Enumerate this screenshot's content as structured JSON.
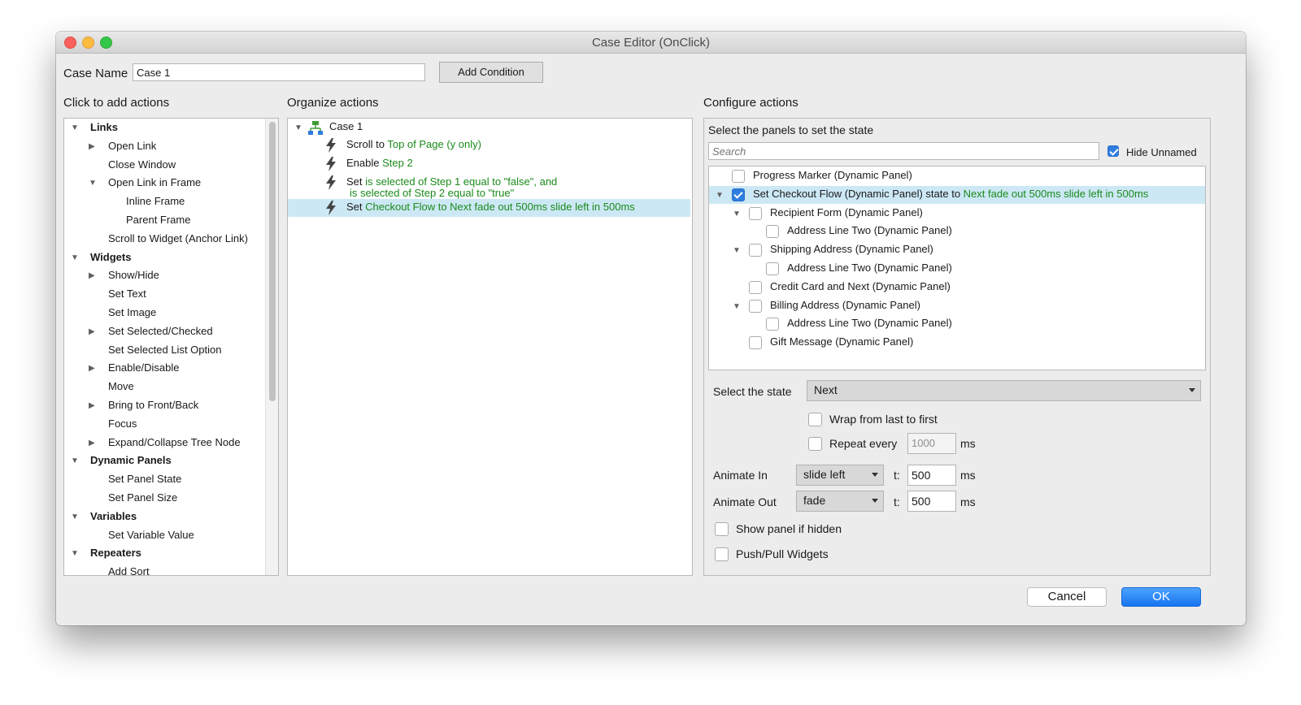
{
  "window": {
    "title": "Case Editor (OnClick)"
  },
  "case_name": {
    "label": "Case Name",
    "value": "Case 1"
  },
  "add_condition_label": "Add Condition",
  "left": {
    "header": "Click to add actions",
    "items": [
      {
        "label": "Links",
        "bold": true,
        "expanded": true
      },
      {
        "label": "Open Link",
        "has_children": true
      },
      {
        "label": "Close Window"
      },
      {
        "label": "Open Link in Frame",
        "expanded": true
      },
      {
        "label": "Inline Frame"
      },
      {
        "label": "Parent Frame"
      },
      {
        "label": "Scroll to Widget (Anchor Link)"
      },
      {
        "label": "Widgets",
        "bold": true,
        "expanded": true
      },
      {
        "label": "Show/Hide",
        "has_children": true
      },
      {
        "label": "Set Text"
      },
      {
        "label": "Set Image"
      },
      {
        "label": "Set Selected/Checked",
        "has_children": true
      },
      {
        "label": "Set Selected List Option"
      },
      {
        "label": "Enable/Disable",
        "has_children": true
      },
      {
        "label": "Move"
      },
      {
        "label": "Bring to Front/Back",
        "has_children": true
      },
      {
        "label": "Focus"
      },
      {
        "label": "Expand/Collapse Tree Node",
        "has_children": true
      },
      {
        "label": "Dynamic Panels",
        "bold": true,
        "expanded": true
      },
      {
        "label": "Set Panel State"
      },
      {
        "label": "Set Panel Size"
      },
      {
        "label": "Variables",
        "bold": true,
        "expanded": true
      },
      {
        "label": "Set Variable Value"
      },
      {
        "label": "Repeaters",
        "bold": true,
        "expanded": true
      },
      {
        "label": "Add Sort"
      }
    ]
  },
  "middle": {
    "header": "Organize actions",
    "case_label": "Case 1",
    "actions": [
      {
        "prefix": "Scroll to ",
        "detail": "Top of Page (y only)"
      },
      {
        "prefix": "Enable ",
        "detail": "Step 2"
      },
      {
        "prefix": "Set ",
        "detail": "is selected of Step 1 equal to \"false\", and",
        "detail2": "is selected of Step 2 equal to \"true\""
      },
      {
        "prefix": "Set ",
        "detail": "Checkout Flow to Next fade out 500ms slide left in 500ms",
        "selected": true
      }
    ]
  },
  "right": {
    "header": "Configure actions",
    "panels_label": "Select the panels to set the state",
    "search_placeholder": "Search",
    "hide_unnamed_label": "Hide Unnamed",
    "hide_unnamed_checked": true,
    "panels": [
      {
        "label": "Progress Marker (Dynamic Panel)",
        "checked": false
      },
      {
        "label": "Set Checkout Flow (Dynamic Panel) state to ",
        "detail": "Next fade out 500ms slide left in 500ms",
        "checked": true,
        "selected": true
      },
      {
        "label": "Recipient Form (Dynamic Panel)",
        "checked": false
      },
      {
        "label": "Address Line Two (Dynamic Panel)",
        "checked": false
      },
      {
        "label": "Shipping Address (Dynamic Panel)",
        "checked": false
      },
      {
        "label": "Address Line Two (Dynamic Panel)",
        "checked": false
      },
      {
        "label": "Credit Card and Next (Dynamic Panel)",
        "checked": false
      },
      {
        "label": "Billing Address (Dynamic Panel)",
        "checked": false
      },
      {
        "label": "Address Line Two (Dynamic Panel)",
        "checked": false
      },
      {
        "label": "Gift Message (Dynamic Panel)",
        "checked": false
      }
    ],
    "state": {
      "label": "Select the state",
      "value": "Next"
    },
    "wrap_label": "Wrap from last to first",
    "repeat_label": "Repeat every",
    "repeat_value": "1000",
    "ms": "ms",
    "animate_in": {
      "label": "Animate In",
      "value": "slide left",
      "t_label": "t:",
      "t_value": "500"
    },
    "animate_out": {
      "label": "Animate Out",
      "value": "fade",
      "t_label": "t:",
      "t_value": "500"
    },
    "show_panel_label": "Show panel if hidden",
    "push_pull_label": "Push/Pull Widgets"
  },
  "footer": {
    "cancel": "Cancel",
    "ok": "OK"
  }
}
